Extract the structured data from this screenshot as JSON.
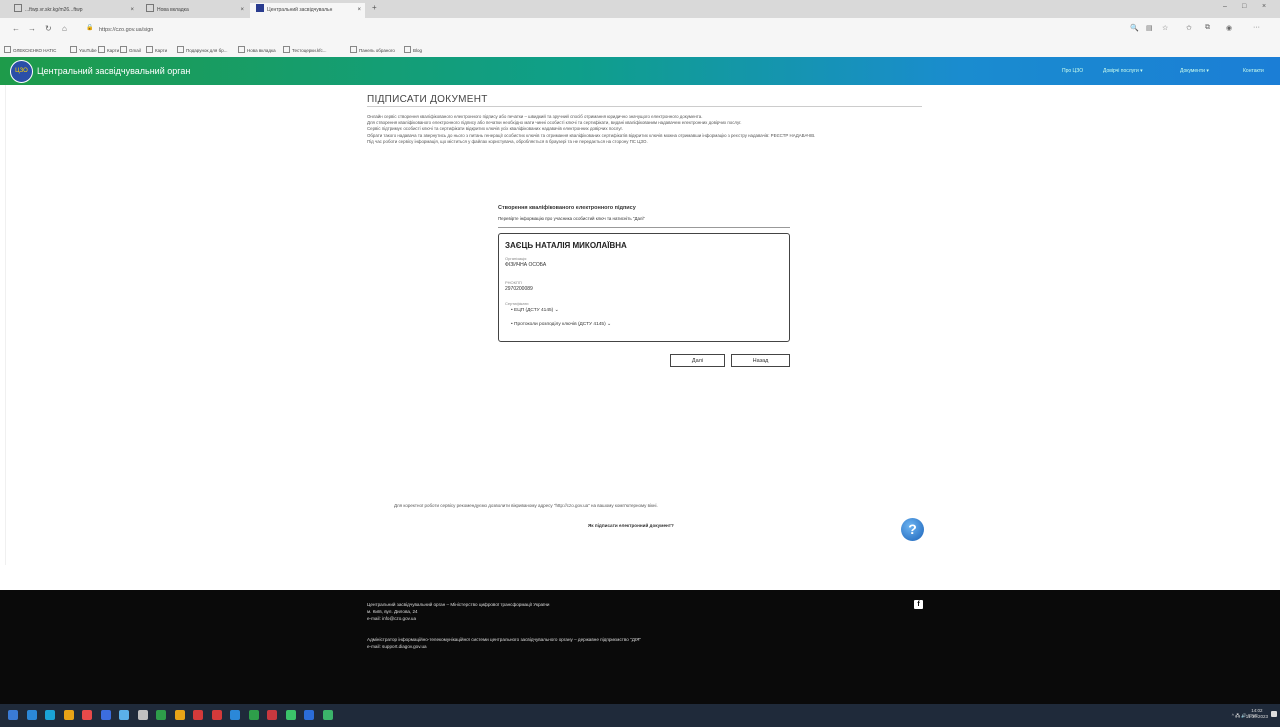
{
  "browser": {
    "tabs": [
      {
        "title": "...ftwp.vr.skr.kg/m26...ftwp"
      },
      {
        "title": "Нова вкладка"
      },
      {
        "title": "Центральний засвідчувальн"
      }
    ],
    "new_tab": "+",
    "close_glyph": "×",
    "window_controls": [
      "–",
      "□",
      "×"
    ],
    "nav": {
      "back": "←",
      "forward": "→",
      "reload": "↻",
      "home": "⌂"
    },
    "url": "https://czo.gov.ua/sign",
    "toolbar_icons": [
      "zoom-icon",
      "reader-icon",
      "star-icon",
      "favorites-icon",
      "collections-icon",
      "profile-icon",
      "more-icon"
    ],
    "toolbar_glyphs": [
      "🔍",
      "▤",
      "☆",
      "✩",
      "⧉",
      "◉",
      "···"
    ],
    "bookmarks": [
      "ОЛЕКСІЄНКО НАТІС",
      "YouTube",
      "Карти",
      "Gmail",
      "Карти",
      "Подарунок для бр...",
      "Нова вкладка",
      "Тестоцерки.kfc...",
      "Панель обраного",
      "Blog"
    ]
  },
  "site": {
    "title": "Центральний засвідчувальний орган",
    "logo_text": "ЦЗО",
    "nav": [
      "Про ЦЗО",
      "Довірчі послуги ▾",
      "Документи ▾",
      "Контакти"
    ]
  },
  "page": {
    "heading": "ПІДПИСАТИ ДОКУМЕНТ",
    "intro": [
      "Онлайн сервіс створення кваліфікованого електронного підпису або печатки – швидкий та зручний спосіб отримання юридично значущого електронного документа.",
      "Для створення кваліфікованого електронного підпису або печатки необхідно мати чинні особисті ключі та сертифікати, видані кваліфікованим надавачем електронних довірчих послуг.",
      "Сервіс підтримує особисті ключі та сертифікати відкритих ключів усіх кваліфікованих надавачів електронних довірчих послуг.",
      "Обрати такого надавача та звернутись до нього з питань генерації особистих ключів та отримання кваліфікованих сертифікатів відкритих ключів можна отримавши інформацію з реєстру надавачів: РЕЄСТР НАДАВАЧІВ.",
      "Під час роботи сервісу інформація, що міститься у файлах користувача, обробляється в браузері та не передається на сторону ПС ЦЗО."
    ],
    "form_title": "Створення кваліфікованого електронного підпису",
    "form_subtitle": "Перевірте інформацію про учасника особистий ключ та натисніть \"Далі\"",
    "signer": {
      "name": "ЗАЄЦЬ НАТАЛІЯ МИКОЛАЇВНА",
      "org_label": "Організація",
      "org_value": "ФІЗИЧНА ОСОБА",
      "rnokpp_label": "РНОКПП",
      "rnokpp_value": "2970200089",
      "certs_label": "Сертифікати",
      "certs": [
        "ЕЦП (ДСТУ 4145) ⌄",
        "Протоколи розподілу ключів (ДСТУ 4145) ⌄"
      ]
    },
    "buttons": {
      "next": "Далі",
      "back": "Назад"
    },
    "notice": "Для коректної роботи сервісу рекомендуємо дозволити вікриваному адресу \"http://czo.gov.ua\" на вашому комп'ютерному вікні.",
    "howto": "Як підписати електронний документ?",
    "help_glyph": "?"
  },
  "footer": {
    "line1": "Центральний засвідчувальний орган – Міністерство цифрової трансформації України",
    "line2": "м. Київ, вул. Дилова, 24",
    "line3": "e-mail: info@czo.gov.ua",
    "line4": "Адміністратор інформаційно-телекомунікаційної системи центрального засвідчувального органу – державне підприємство \"ДІЯ\"",
    "line5": "e-mail: support.diagov.gov.ua",
    "facebook_glyph": "f"
  },
  "taskbar": {
    "tray": "^ 🖧 🔊 ENG",
    "time": "14:02",
    "date": "11.10.2023",
    "icon_colors": [
      "#3a7bd5",
      "#2b88d8",
      "#1aa3d8",
      "#e8a317",
      "#e84a4a",
      "#3c6de0",
      "#5bb0e8",
      "#c0c0c0",
      "#2e9e4a",
      "#e8a317",
      "#d43a3a",
      "#d43a3a",
      "#2b88d8",
      "#2e9e4a",
      "#c8383f",
      "#3bc36a",
      "#2b6cd8",
      "#3bb36a"
    ]
  }
}
